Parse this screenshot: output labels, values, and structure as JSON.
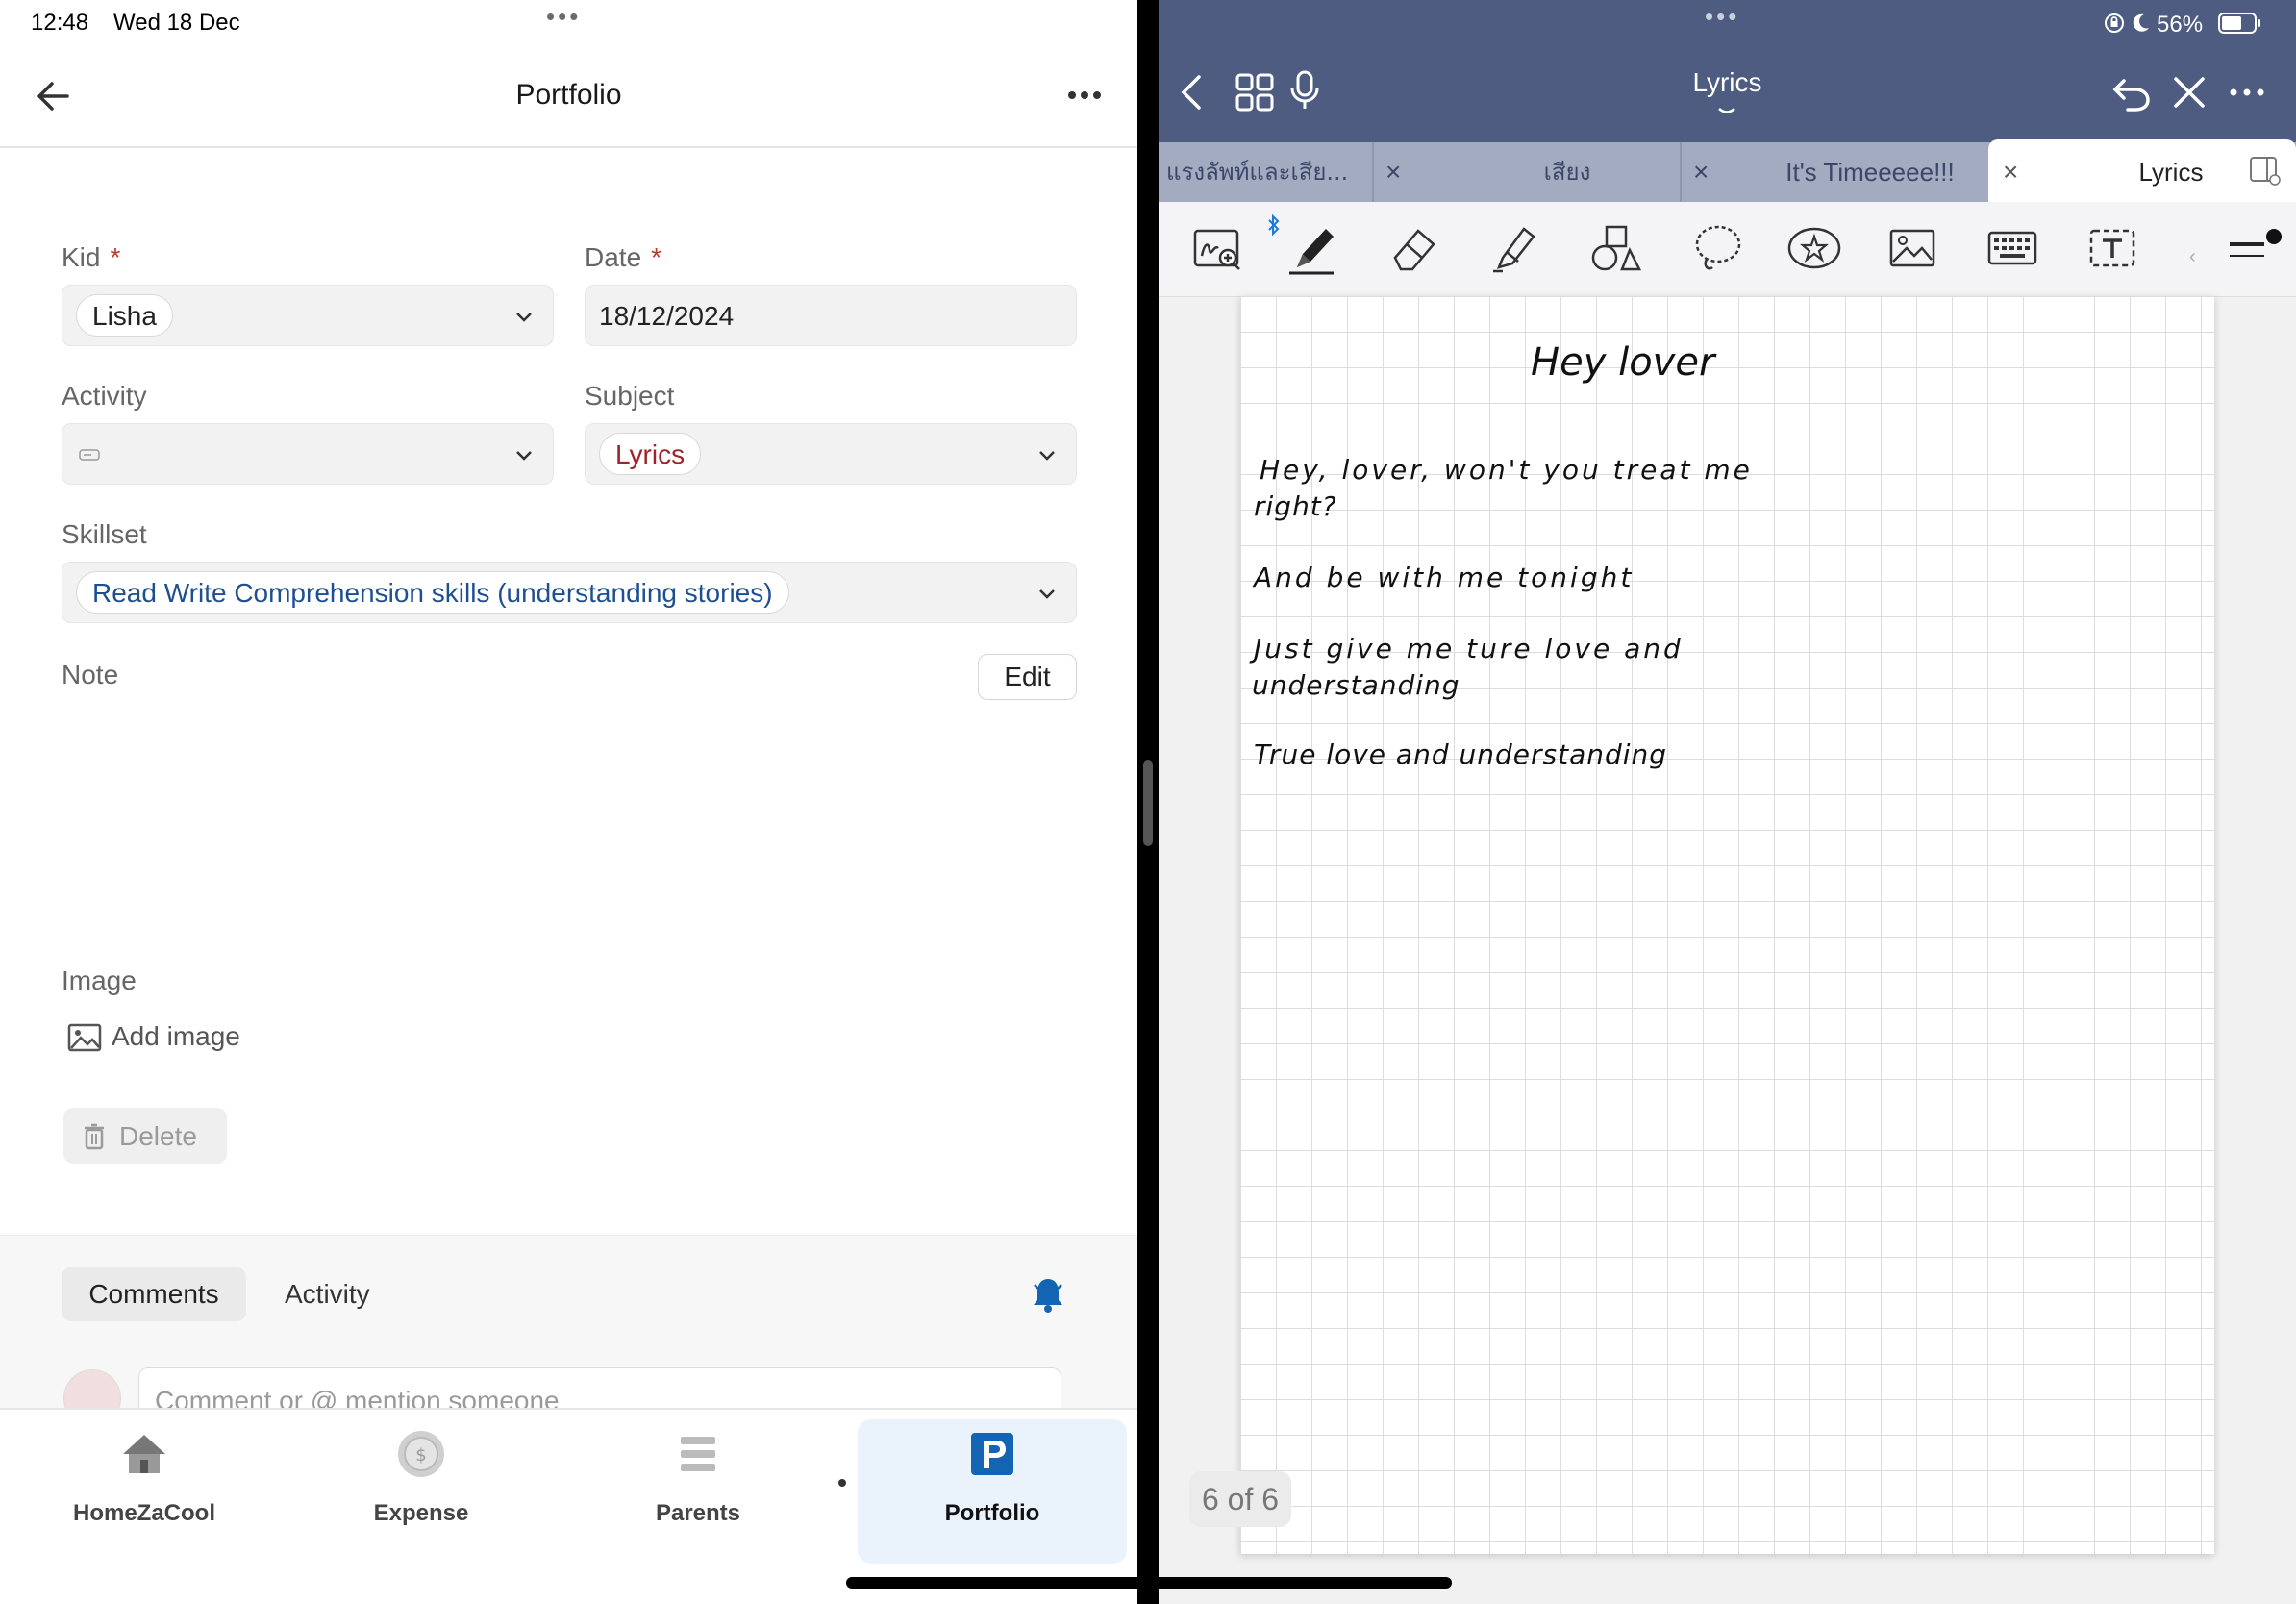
{
  "status_bar": {
    "time": "12:48",
    "date": "Wed 18 Dec",
    "battery": "56%"
  },
  "left": {
    "header": {
      "title": "Portfolio"
    },
    "form": {
      "kid": {
        "label": "Kid",
        "required_mark": "*",
        "value": "Lisha"
      },
      "date": {
        "label": "Date",
        "required_mark": "*",
        "value": "18/12/2024"
      },
      "activity": {
        "label": "Activity"
      },
      "subject": {
        "label": "Subject",
        "value": "Lyrics"
      },
      "skillset": {
        "label": "Skillset",
        "value": "Read Write Comprehension skills (understanding stories)"
      },
      "note": {
        "label": "Note",
        "edit_label": "Edit"
      },
      "image": {
        "label": "Image",
        "add_label": "Add image"
      },
      "delete_label": "Delete"
    },
    "comments": {
      "tabs": [
        "Comments",
        "Activity"
      ],
      "placeholder": "Comment or @ mention someone"
    },
    "bottom_nav": [
      {
        "label": "HomeZaCool",
        "icon": "home-icon"
      },
      {
        "label": "Expense",
        "icon": "coin-icon"
      },
      {
        "label": "Parents",
        "icon": "list-icon"
      },
      {
        "label": "Portfolio",
        "icon": "portfolio-p-icon",
        "active": true
      }
    ],
    "colors": {
      "accent": "#1464b4",
      "active_nav_bg": "#eaf3fb",
      "subject_text": "#a0222a",
      "skill_text": "#1d4f91"
    }
  },
  "right": {
    "title": "Lyrics",
    "tabs": [
      {
        "label": "แรงลัพท์และเสีย..."
      },
      {
        "label": "เสียง"
      },
      {
        "label": "It's Timeeeee!!!"
      },
      {
        "label": "Lyrics",
        "active": true
      }
    ],
    "notes": {
      "heading": "Hey lover",
      "lines": [
        "Hey, lover, won't you treat me",
        "right?",
        "And be with me tonight",
        "Just give me ture love and",
        "understanding",
        "True love and understanding"
      ]
    },
    "page_indicator": "6 of 6",
    "colors": {
      "topbar": "#4d5c80",
      "tabs": "#a3abc0"
    }
  }
}
